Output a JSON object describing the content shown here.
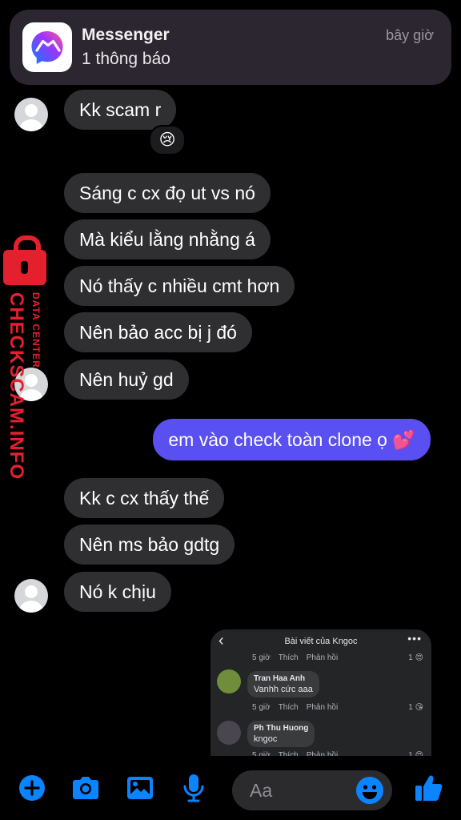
{
  "notification": {
    "app_name": "Messenger",
    "subtitle": "1 thông báo",
    "time": "bây giờ"
  },
  "messages": [
    {
      "text": "Kk scam r",
      "side": "in"
    },
    {
      "text": "Sáng c cx đọ ut vs nó",
      "side": "in"
    },
    {
      "text": "Mà kiểu lằng nhằng á",
      "side": "in"
    },
    {
      "text": "Nó thấy c nhiều cmt hơn",
      "side": "in"
    },
    {
      "text": "Nên bảo acc bị j đó",
      "side": "in"
    },
    {
      "text": "Nên huỷ gd",
      "side": "in"
    },
    {
      "text": "em vào check toàn clone ọ 💕",
      "side": "out"
    },
    {
      "text": "Kk c cx thấy thế",
      "side": "in"
    },
    {
      "text": "Nên ms bảo gdtg",
      "side": "in"
    },
    {
      "text": "Nó k chịu",
      "side": "in"
    }
  ],
  "reaction": "😢",
  "watermark": {
    "main": "CHECKSCAM.INFO",
    "sub": "DATA CENTER"
  },
  "shared_post": {
    "header": "Bài viết của Kngoc",
    "meta": {
      "time": "5 giờ",
      "like": "Thích",
      "reply": "Phản hồi"
    },
    "counts": [
      "1",
      "1",
      "1"
    ],
    "comments": [
      {
        "name": "Tran Haa Anh",
        "text": "Vanhh cức aaa"
      },
      {
        "name": "Ph Thu Huong",
        "text": "kngoc"
      }
    ]
  },
  "composer": {
    "placeholder": "Aa"
  },
  "colors": {
    "accent": "#0a84ff",
    "outgoing_bubble": "#5a4ff0",
    "incoming_bubble": "#2f2f31",
    "watermark": "#e5202e"
  }
}
